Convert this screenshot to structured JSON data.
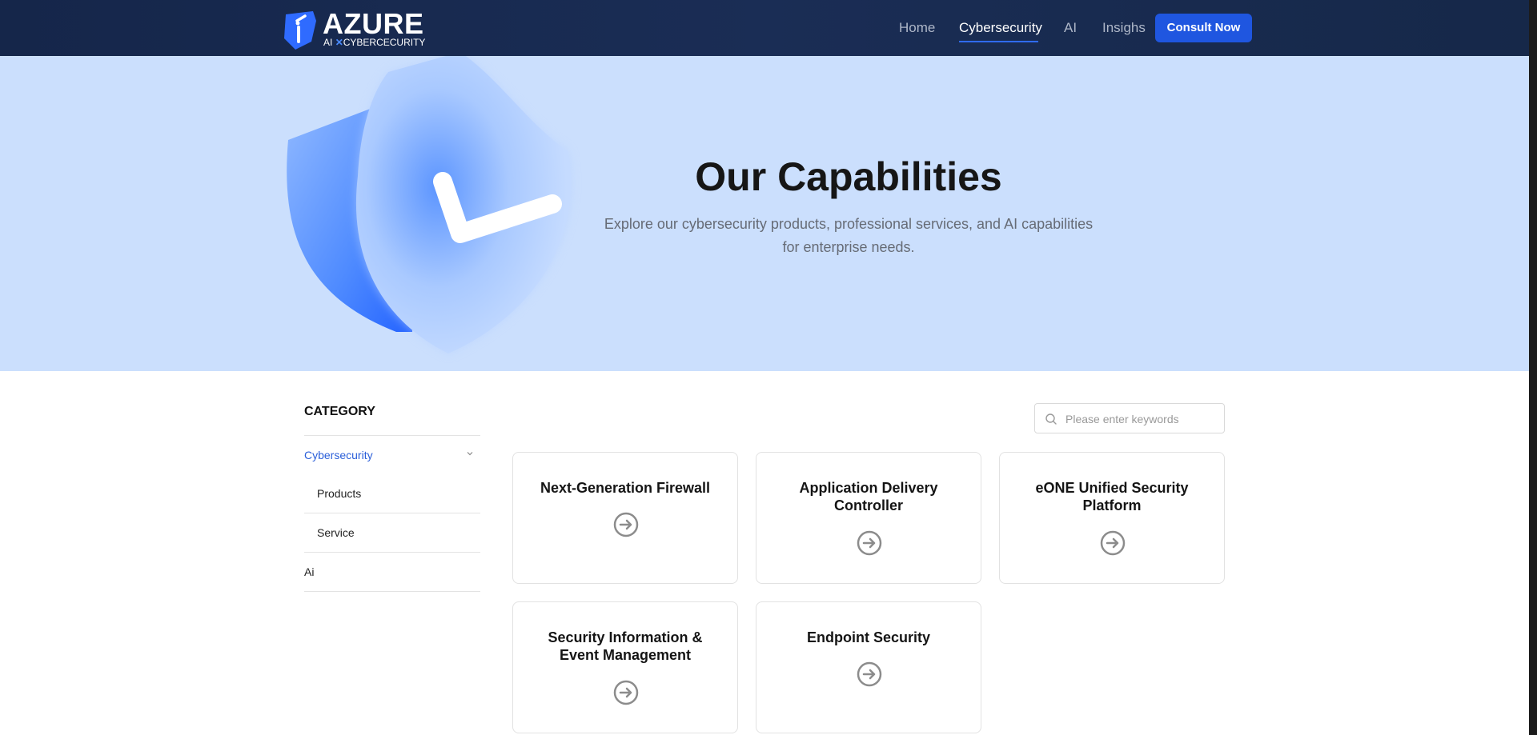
{
  "header": {
    "logo_title": "AZURE",
    "logo_sub_left": "AI",
    "logo_sub_x": "✕",
    "logo_sub_right": "CYBERCECURITY",
    "nav": [
      {
        "label": "Home",
        "active": false
      },
      {
        "label": "Cybersecurity",
        "active": true
      },
      {
        "label": "AI",
        "active": false
      },
      {
        "label": "Insighs",
        "active": false
      }
    ],
    "cta_label": "Consult Now"
  },
  "hero": {
    "title": "Our Capabilities",
    "subtitle_line1": "Explore our cybersecurity products, professional services, and AI capabilities",
    "subtitle_line2": "for enterprise needs."
  },
  "sidebar": {
    "title": "CATEGORY",
    "items": [
      {
        "label": "Cybersecurity",
        "active": true,
        "expanded": true
      },
      {
        "label": "Products",
        "level": 2
      },
      {
        "label": "Service",
        "level": 2
      },
      {
        "label": "Ai",
        "active": false
      }
    ]
  },
  "search": {
    "placeholder": "Please enter keywords",
    "value": ""
  },
  "cards": [
    {
      "title": "Next-Generation Firewall"
    },
    {
      "title": "Application Delivery Controller"
    },
    {
      "title": "eONE Unified Security Platform"
    },
    {
      "title": "Security Information & Event Management"
    },
    {
      "title": "Endpoint Security"
    }
  ],
  "colors": {
    "accent": "#1f56e0",
    "header_bg": "#15264a",
    "hero_bg": "#cbdffd",
    "active_link": "#2b5fd9"
  }
}
